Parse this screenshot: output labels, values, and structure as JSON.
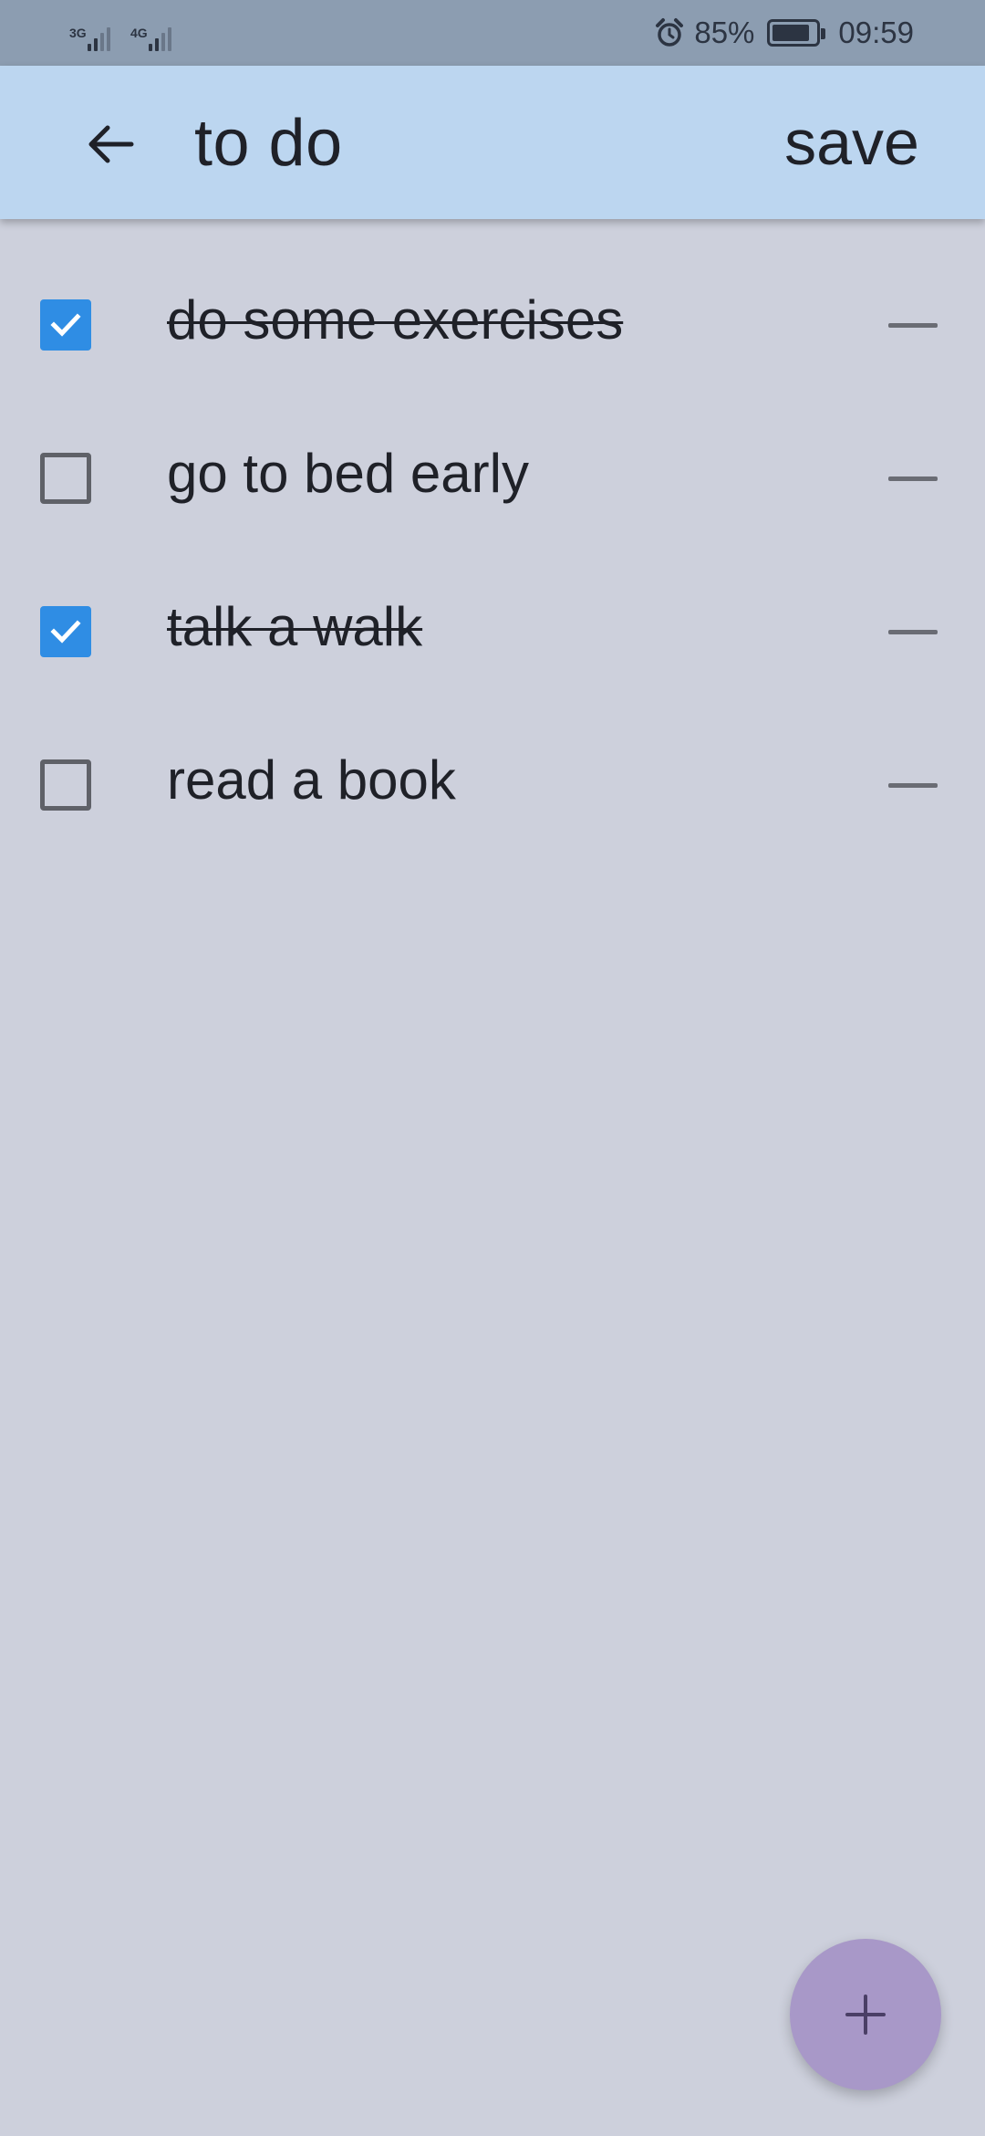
{
  "status_bar": {
    "signal_1_label": "3G",
    "signal_2_label": "4G",
    "battery_percent": "85%",
    "battery_level": 0.85,
    "time": "09:59",
    "icons": [
      "alarm-icon",
      "battery-icon"
    ]
  },
  "app_bar": {
    "title": "to do",
    "save_label": "save",
    "background": "#bcd6f0"
  },
  "todos": [
    {
      "text": "do some exercises",
      "checked": true
    },
    {
      "text": "go to bed early",
      "checked": false
    },
    {
      "text": "talk a walk",
      "checked": true
    },
    {
      "text": "read a book",
      "checked": false
    }
  ],
  "colors": {
    "page_background": "#cdd0dc",
    "checkbox_checked": "#2f8de4",
    "fab": "#a898c8"
  }
}
